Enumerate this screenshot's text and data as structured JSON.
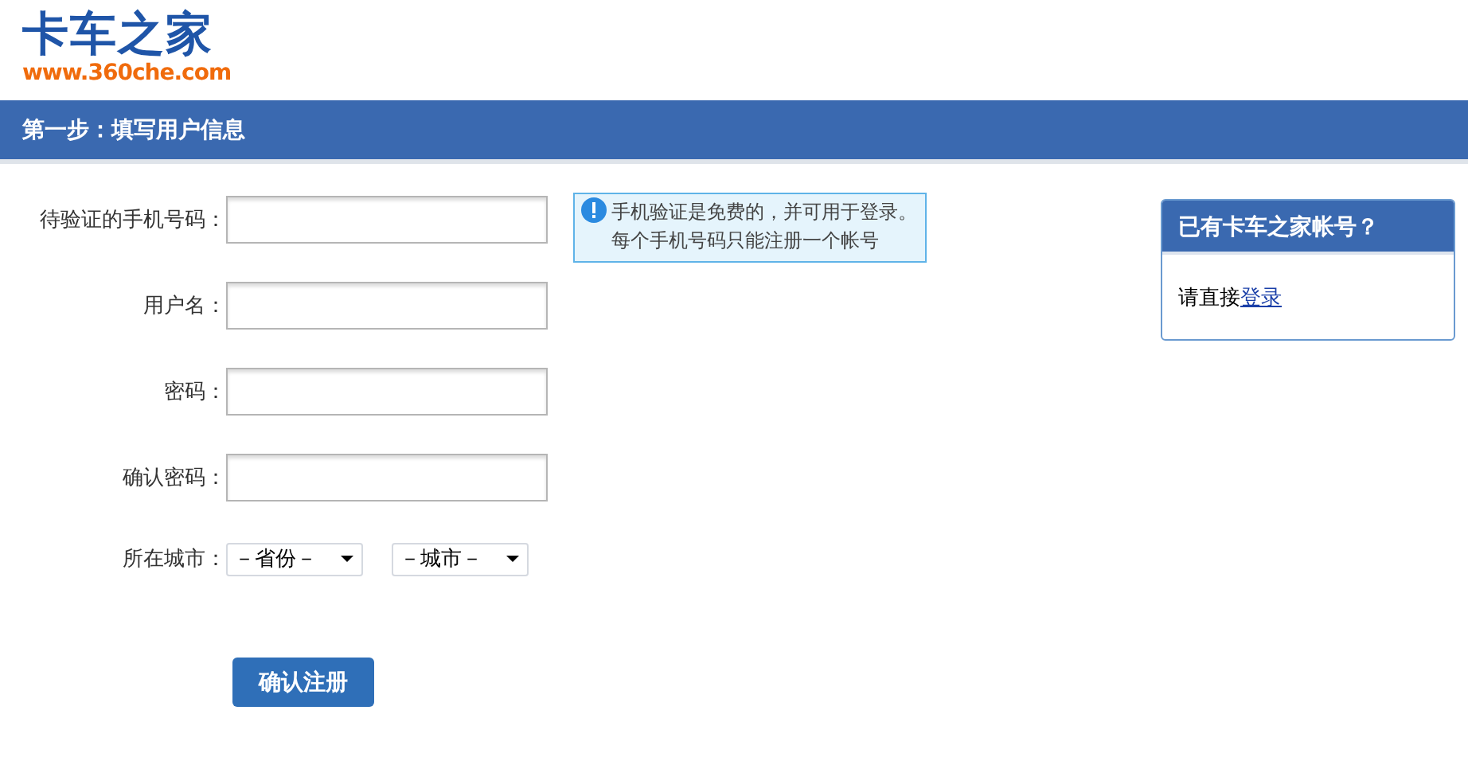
{
  "logo": {
    "name": "卡车之家",
    "url": "www.360che.com"
  },
  "step_bar": {
    "title": "第一步：填写用户信息"
  },
  "form": {
    "fields": [
      {
        "kind": "text",
        "label": "待验证的手机号码："
      },
      {
        "kind": "text",
        "label": "用户名："
      },
      {
        "kind": "text",
        "label": "密码："
      },
      {
        "kind": "text",
        "label": "确认密码："
      }
    ],
    "city": {
      "label": "所在城市：",
      "selects": [
        "－省份－",
        "－城市－"
      ]
    },
    "tip": {
      "lines": [
        "手机验证是免费的，并可用于登录。",
        "每个手机号码只能注册一个帐号"
      ]
    },
    "submit": "确认注册"
  },
  "login_box": {
    "title": "已有卡车之家帐号？",
    "prompt": "请直接",
    "link": "登录"
  }
}
